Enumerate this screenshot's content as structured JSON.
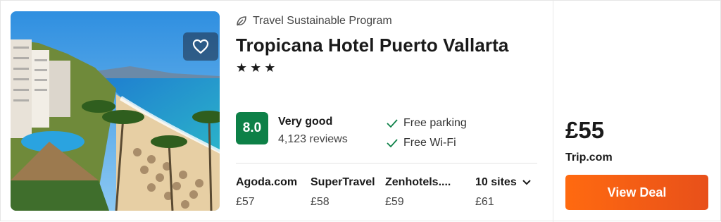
{
  "hotel": {
    "sustainability_label": "Travel Sustainable Program",
    "name": "Tropicana Hotel Puerto Vallarta",
    "stars_display": "★★★",
    "star_rating": 3
  },
  "rating": {
    "score": "8.0",
    "label": "Very good",
    "reviews": "4,123 reviews",
    "badge_color": "#0d8047"
  },
  "amenities": [
    {
      "label": "Free parking"
    },
    {
      "label": "Free Wi-Fi"
    }
  ],
  "sites": [
    {
      "name": "Agoda.com",
      "price": "£57"
    },
    {
      "name": "SuperTravel",
      "price": "£58"
    },
    {
      "name": "Zenhotels....",
      "price": "£59"
    }
  ],
  "more_sites": {
    "label": "10 sites",
    "price": "£61"
  },
  "deal": {
    "price": "£55",
    "site": "Trip.com",
    "button_label": "View Deal",
    "button_color": "#ff6a10"
  },
  "icons": {
    "favorite": "heart-icon",
    "sustainability": "leaf-icon",
    "amenity": "check-icon",
    "dropdown": "chevron-down-icon"
  }
}
